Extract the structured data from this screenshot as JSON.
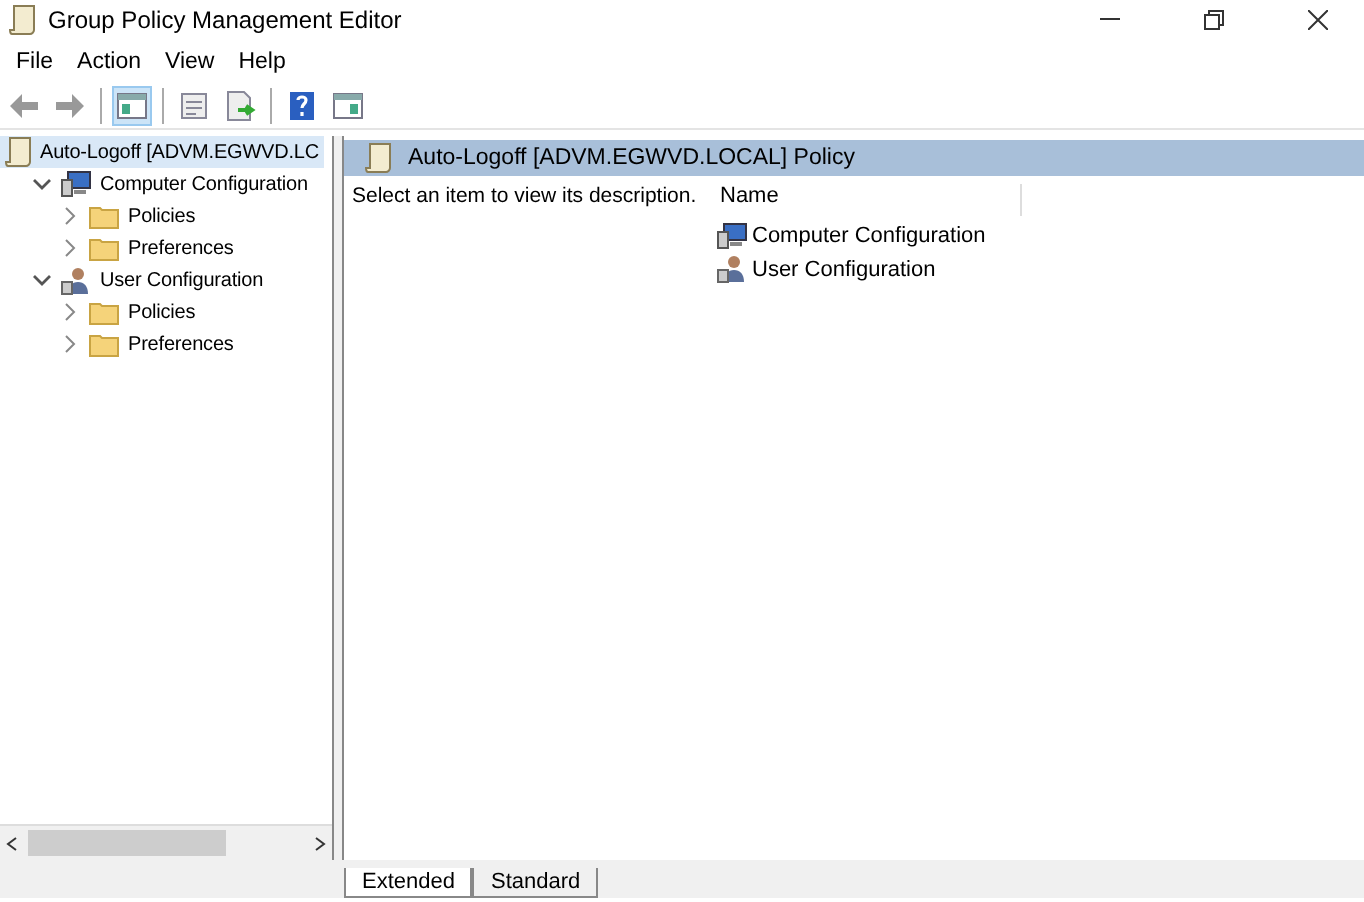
{
  "window": {
    "title": "Group Policy Management Editor"
  },
  "menu": [
    "File",
    "Action",
    "View",
    "Help"
  ],
  "toolbar": [
    {
      "kind": "back",
      "pressed": false
    },
    {
      "kind": "forward",
      "pressed": false
    },
    {
      "kind": "sep"
    },
    {
      "kind": "tree",
      "pressed": true
    },
    {
      "kind": "sep"
    },
    {
      "kind": "properties",
      "pressed": false
    },
    {
      "kind": "export",
      "pressed": false
    },
    {
      "kind": "sep"
    },
    {
      "kind": "help",
      "pressed": false
    },
    {
      "kind": "pane",
      "pressed": false
    }
  ],
  "tree": [
    {
      "label": "Auto-Logoff [ADVM.EGWVD.LC",
      "kind": "policy",
      "selected": true,
      "children": [
        {
          "label": "Computer Configuration",
          "kind": "computer",
          "expanded": true,
          "selected": false,
          "children": [
            {
              "label": "Policies",
              "kind": "folder",
              "expanded": false,
              "selected": false
            },
            {
              "label": "Preferences",
              "kind": "folder",
              "expanded": false,
              "selected": false
            }
          ]
        },
        {
          "label": "User Configuration",
          "kind": "user",
          "expanded": true,
          "selected": false,
          "children": [
            {
              "label": "Policies",
              "kind": "folder",
              "expanded": false,
              "selected": false
            },
            {
              "label": "Preferences",
              "kind": "folder",
              "expanded": false,
              "selected": false
            }
          ]
        }
      ]
    }
  ],
  "details": {
    "title": "Auto-Logoff [ADVM.EGWVD.LOCAL] Policy",
    "description": "Select an item to view its description.",
    "column": "Name",
    "items": [
      {
        "label": "Computer Configuration",
        "kind": "computer"
      },
      {
        "label": "User Configuration",
        "kind": "user"
      }
    ]
  },
  "view_tabs": [
    {
      "label": "Extended",
      "selected": true
    },
    {
      "label": "Standard",
      "selected": false
    }
  ]
}
